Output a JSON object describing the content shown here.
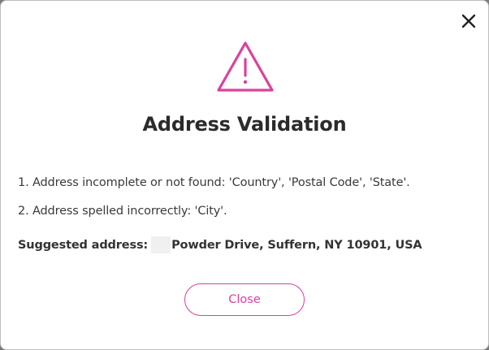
{
  "dialog": {
    "title": "Address Validation",
    "icon": "warning-triangle-icon",
    "accent_color": "#d9429d",
    "messages": [
      "1. Address incomplete or not found: 'Country', 'Postal Code', 'State'.",
      "2. Address spelled incorrectly: 'City'."
    ],
    "suggested_label": "Suggested address:",
    "suggested_value": "Powder Drive, Suffern, NY 10901, USA",
    "close_button_label": "Close",
    "close_icon": "close-icon"
  }
}
